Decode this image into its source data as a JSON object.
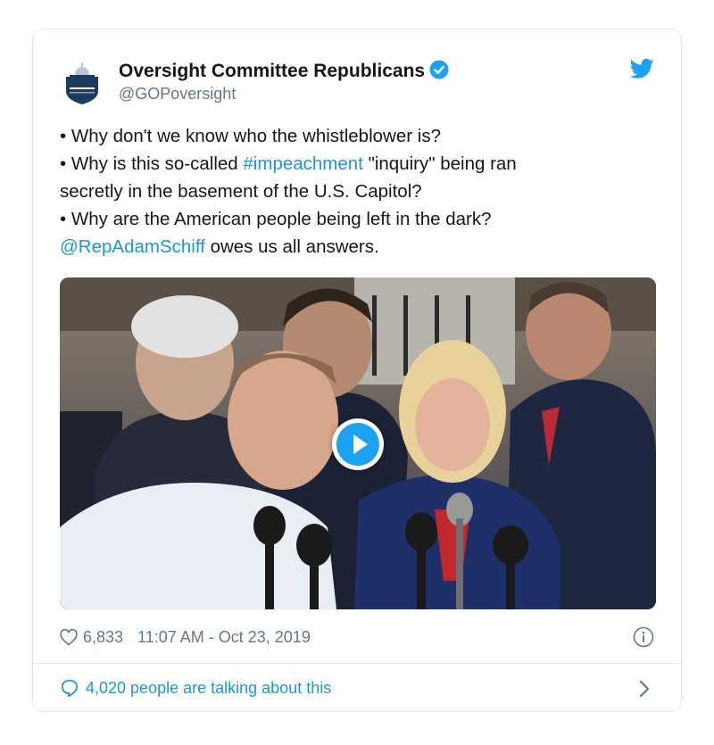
{
  "tweet": {
    "account_name": "Oversight Committee Republicans",
    "handle": "@GOPoversight",
    "verified": true,
    "lines": [
      {
        "prefix": "• Why don't we know who the whistleblower is?",
        "link": "",
        "suffix": ""
      },
      {
        "prefix": "• Why is this so-called ",
        "link": "#impeachment",
        "suffix": " \"inquiry\" being ran"
      },
      {
        "prefix": "secretly in the basement of the U.S. Capitol?",
        "link": "",
        "suffix": ""
      },
      {
        "prefix": "• Why are the American people being left in the dark?",
        "link": "",
        "suffix": ""
      },
      {
        "prefix": "",
        "link": "@RepAdamSchiff",
        "suffix": " owes us all answers."
      }
    ],
    "likes": "6,833",
    "timestamp": "11:07 AM - Oct 23, 2019",
    "talking": "4,020 people are talking about this"
  },
  "icons": {
    "avatar": "congress-seal-avatar",
    "verified": "verified-badge-icon",
    "logo": "twitter-bird-icon",
    "play": "play-icon",
    "like": "heart-icon",
    "info": "info-icon",
    "reply": "speech-bubble-icon",
    "chevron": "chevron-right-icon"
  },
  "colors": {
    "link": "#1b95e0",
    "twitter_blue": "#1da1f2",
    "secondary_text": "#657786",
    "border": "#e1e8ed",
    "seal_navy": "#1d3a5f"
  }
}
